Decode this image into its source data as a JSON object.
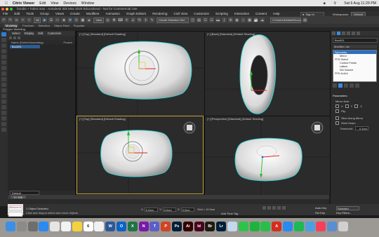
{
  "mac_menu": {
    "apple": "",
    "app_name": "Citrix Viewer",
    "items": [
      "Edit",
      "View",
      "Devices",
      "Window"
    ],
    "clock": "Sat 6 Aug  11:29 PM"
  },
  "app_title": "hoodie + hole2.max - Autodesk 3ds Max 2020 Educational - Not for Commercial Use",
  "app_menu": {
    "items": [
      "File",
      "Edit",
      "Tools",
      "Group",
      "Views",
      "Create",
      "Modifiers",
      "Animation",
      "Graph Editors",
      "Rendering",
      "Civil View",
      "Customize",
      "Scripting",
      "Interactive",
      "Content",
      "Help"
    ],
    "signin": "Sign In",
    "workspaces_label": "Workspaces:",
    "workspace_value": "Default"
  },
  "toolbar": {
    "select_filter": "All",
    "view_label": "View",
    "selection_set": "Create Selection Set",
    "path": "C:\\Users\\Default\\Docu..."
  },
  "ribbon": {
    "tabs": [
      "Modeling",
      "Freeform",
      "Selection",
      "Object Paint",
      "Populate"
    ],
    "active": "Modeling",
    "sub": "Polygon Modeling"
  },
  "scene_explorer": {
    "tabs": [
      "Select",
      "Display",
      "Edit",
      "Customize"
    ],
    "header": "Name (Sorted Ascending)",
    "frozen_label": "Frozen",
    "items": [
      "Box001"
    ]
  },
  "layer": "Default",
  "viewports": [
    {
      "label": "[+] [Top] [Standard] [Default Shading]"
    },
    {
      "label": "[+] [Back] [Standard] [Default Shading]"
    },
    {
      "label": "[+] [Top] [Standard] [Default Shading]"
    },
    {
      "label": "[+] [Perspective] [Standard] [Default Shading]"
    }
  ],
  "command_panel": {
    "object_name": "Box001",
    "modifier_list": "Modifier List",
    "stack": [
      {
        "label": "Symmetry",
        "level": 0,
        "selected": true
      },
      {
        "label": "Mirror",
        "level": 1,
        "selected": false
      },
      {
        "label": "FFD Select",
        "level": 0,
        "selected": false
      },
      {
        "label": "Control Points",
        "level": 1,
        "selected": false
      },
      {
        "label": "Lattice",
        "level": 1,
        "selected": false
      },
      {
        "label": "Set Volume",
        "level": 1,
        "selected": false
      },
      {
        "label": "FFD 4x4x4",
        "level": 0,
        "selected": false
      }
    ],
    "parameters": {
      "title": "Parameters",
      "mirror_axis": "Mirror Axis:",
      "axes": [
        "X",
        "Y",
        "Z"
      ],
      "flip": "Flip",
      "slice": "Slice Along Mirror",
      "weld": "Weld Seam",
      "threshold_label": "Threshold:",
      "threshold_value": "0.1cm"
    }
  },
  "timeslider": "0 / 100",
  "status": {
    "line1": "1 Object Selected",
    "line2": "Click and drag to select and move objects",
    "maxscript": [
      "Welcome to MAXScript."
    ],
    "x_label": "X:",
    "x_value": "0.0cm",
    "y_label": "Y:",
    "y_value": "0.0cm",
    "z_label": "Z:",
    "z_value": "0.0cm",
    "grid": "Grid = 10.0cm",
    "add_time_tag": "Add Time Tag",
    "auto_key": "Auto Key",
    "selected": "Selected",
    "set_key": "Set Key",
    "key_filters": "Key Filters..."
  },
  "dock": {
    "apps": [
      {
        "name": "finder",
        "color": "#3d8fe6",
        "glyph": ""
      },
      {
        "name": "launchpad",
        "color": "#8b8b8b",
        "glyph": ""
      },
      {
        "name": "system-preferences",
        "color": "#6e6e6e",
        "glyph": ""
      },
      {
        "name": "safari",
        "color": "#2a8af0",
        "glyph": ""
      },
      {
        "name": "chrome",
        "color": "#e5e5e5",
        "glyph": ""
      },
      {
        "name": "photos",
        "color": "#f2f2f2",
        "glyph": ""
      },
      {
        "name": "notes",
        "color": "#f5d23c",
        "glyph": ""
      },
      {
        "name": "calendar",
        "color": "#ffffff",
        "glyph": "6"
      },
      {
        "name": "reminders",
        "color": "#f1f1f1",
        "glyph": ""
      },
      {
        "name": "word",
        "color": "#2b579a",
        "glyph": "W"
      },
      {
        "name": "outlook",
        "color": "#0a64c8",
        "glyph": "O"
      },
      {
        "name": "excel",
        "color": "#217346",
        "glyph": "X"
      },
      {
        "name": "onenote",
        "color": "#7719aa",
        "glyph": "N"
      },
      {
        "name": "teams",
        "color": "#5b5fc7",
        "glyph": "T"
      },
      {
        "name": "powerpoint",
        "color": "#d04423",
        "glyph": "P"
      },
      {
        "name": "photoshop",
        "color": "#001e36",
        "glyph": "Ps"
      },
      {
        "name": "illustrator",
        "color": "#330000",
        "glyph": "Ai"
      },
      {
        "name": "indesign",
        "color": "#49021f",
        "glyph": "Id"
      },
      {
        "name": "bridge",
        "color": "#1f1a11",
        "glyph": "Br"
      },
      {
        "name": "lightroom",
        "color": "#001e36",
        "glyph": "Lr"
      },
      {
        "name": "preview",
        "color": "#c2d9ee",
        "glyph": ""
      },
      {
        "name": "messages",
        "color": "#2fc34a",
        "glyph": ""
      },
      {
        "name": "wechat",
        "color": "#1fb33d",
        "glyph": ""
      },
      {
        "name": "facetime",
        "color": "#2bbd4a",
        "glyph": ""
      },
      {
        "name": "autodesk",
        "color": "#d42d1f",
        "glyph": "A"
      },
      {
        "name": "app-store",
        "color": "#2a8af0",
        "glyph": ""
      },
      {
        "name": "spotify",
        "color": "#1db954",
        "glyph": ""
      },
      {
        "name": "citrix",
        "color": "#4aa0e0",
        "glyph": ""
      },
      {
        "name": "music",
        "color": "#f5405a",
        "glyph": ""
      },
      {
        "name": "downloads",
        "color": "#5a8ed0",
        "glyph": ""
      },
      {
        "name": "trash",
        "color": "#d0d0d0",
        "glyph": ""
      }
    ]
  }
}
